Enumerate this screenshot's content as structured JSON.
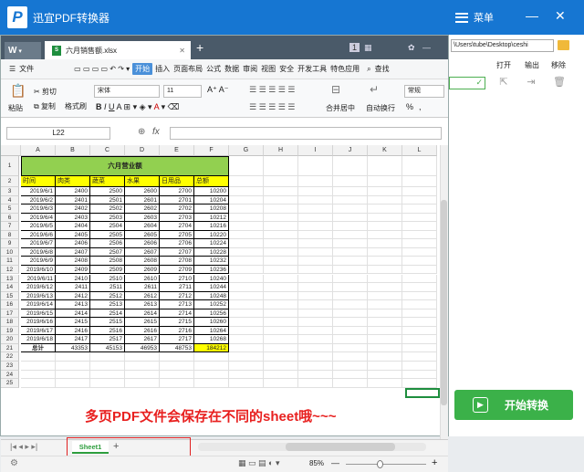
{
  "app": {
    "title": "迅宜PDF转换器",
    "menu_label": "菜单",
    "minimize": "—",
    "close": "✕"
  },
  "right_panel": {
    "path": "\\Users\\tube\\Desktop\\ceshi",
    "headers": [
      "打开",
      "输出",
      "移除"
    ],
    "start_label": "开始转换"
  },
  "wps": {
    "logo": "W",
    "file_tab": "六月销售额.xlsx",
    "page_num": "1",
    "menu_items": [
      "文件",
      "开始",
      "插入",
      "页面布局",
      "公式",
      "数据",
      "审阅",
      "视图",
      "安全",
      "开发工具",
      "特色应用",
      "查找"
    ],
    "ribbon": {
      "paste": "粘贴",
      "cut": "剪切",
      "copy": "复制",
      "format_painter": "格式刷",
      "font": "宋体",
      "font_size": "11",
      "merge": "合并居中",
      "wrap": "自动换行",
      "number_format": "常规",
      "percent": "%",
      "comma": ","
    },
    "cell_ref": "L22",
    "fx": "fx",
    "sheet_tab": "Sheet1",
    "zoom": "85%"
  },
  "sheet": {
    "columns": [
      "A",
      "B",
      "C",
      "D",
      "E",
      "F",
      "G",
      "H",
      "I",
      "J",
      "K",
      "L"
    ],
    "title": "六月营业额",
    "headers": [
      "时间",
      "肉类",
      "蔬菜",
      "水果",
      "日用品",
      "总额"
    ],
    "rows": [
      [
        "2019/6/1",
        "2400",
        "2500",
        "2600",
        "2700",
        "10200"
      ],
      [
        "2019/6/2",
        "2401",
        "2501",
        "2601",
        "2701",
        "10204"
      ],
      [
        "2019/6/3",
        "2402",
        "2502",
        "2602",
        "2702",
        "10208"
      ],
      [
        "2019/6/4",
        "2403",
        "2503",
        "2603",
        "2703",
        "10212"
      ],
      [
        "2019/6/5",
        "2404",
        "2504",
        "2604",
        "2704",
        "10216"
      ],
      [
        "2019/6/6",
        "2405",
        "2505",
        "2605",
        "2705",
        "10220"
      ],
      [
        "2019/6/7",
        "2406",
        "2506",
        "2606",
        "2706",
        "10224"
      ],
      [
        "2019/6/8",
        "2407",
        "2507",
        "2607",
        "2707",
        "10228"
      ],
      [
        "2019/6/9",
        "2408",
        "2508",
        "2608",
        "2708",
        "10232"
      ],
      [
        "2019/6/10",
        "2409",
        "2509",
        "2609",
        "2709",
        "10236"
      ],
      [
        "2019/6/11",
        "2410",
        "2510",
        "2610",
        "2710",
        "10240"
      ],
      [
        "2019/6/12",
        "2411",
        "2511",
        "2611",
        "2711",
        "10244"
      ],
      [
        "2019/6/13",
        "2412",
        "2512",
        "2612",
        "2712",
        "10248"
      ],
      [
        "2019/6/14",
        "2413",
        "2513",
        "2613",
        "2713",
        "10252"
      ],
      [
        "2019/6/15",
        "2414",
        "2514",
        "2614",
        "2714",
        "10256"
      ],
      [
        "2019/6/16",
        "2415",
        "2515",
        "2615",
        "2715",
        "10260"
      ],
      [
        "2019/6/17",
        "2416",
        "2516",
        "2616",
        "2716",
        "10264"
      ],
      [
        "2019/6/18",
        "2417",
        "2517",
        "2617",
        "2717",
        "10268"
      ]
    ],
    "total": [
      "总计",
      "43353",
      "45153",
      "46953",
      "48753",
      "184212"
    ]
  },
  "annotation": "多页PDF文件会保存在不同的sheet哦~~~",
  "colors": {
    "brand": "#1676d2",
    "green": "#3bb149",
    "annotation": "#e8201f",
    "title_fill": "#92d050",
    "header_fill": "#ffff00"
  }
}
